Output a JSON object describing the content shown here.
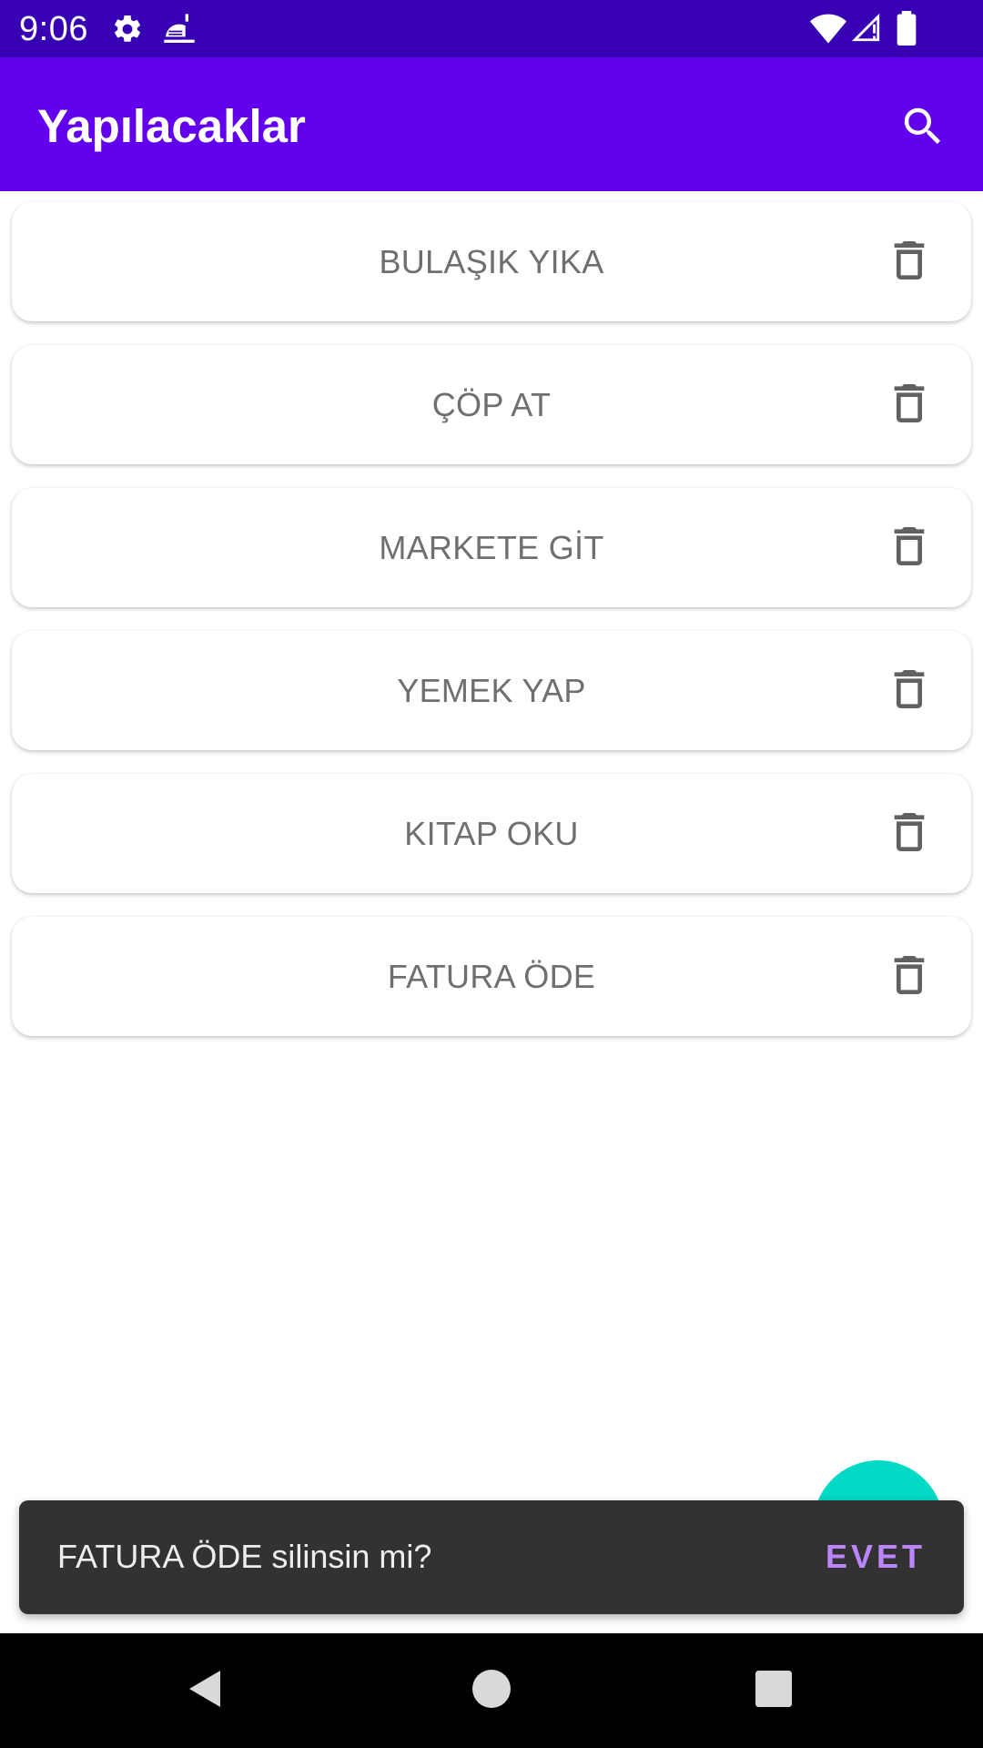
{
  "status_bar": {
    "time": "9:06",
    "icons": [
      "gear-icon",
      "food-tray-icon",
      "wifi-icon",
      "signal-icon",
      "battery-icon"
    ]
  },
  "app_bar": {
    "title": "Yapılacaklar",
    "search_icon": "search-icon",
    "color": "#6200ee"
  },
  "todos": [
    {
      "label": "BULAŞIK YIKA"
    },
    {
      "label": "ÇÖP AT"
    },
    {
      "label": "MARKETE GİT"
    },
    {
      "label": "YEMEK YAP"
    },
    {
      "label": "KITAP OKU"
    },
    {
      "label": "FATURA ÖDE"
    }
  ],
  "snackbar": {
    "message": "FATURA ÖDE silinsin mi?",
    "action": "EVET",
    "action_color": "#bb86fc"
  },
  "fab": {
    "color": "#03dac5"
  },
  "nav_bar": {
    "icons": [
      "back-icon",
      "home-icon",
      "recents-icon"
    ]
  }
}
